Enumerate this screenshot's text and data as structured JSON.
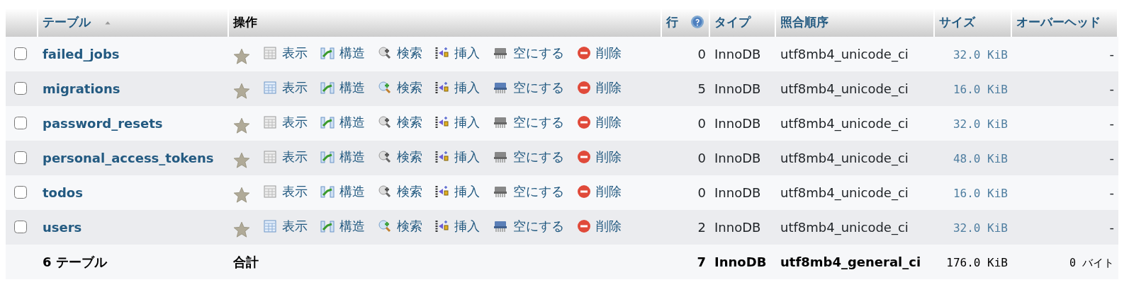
{
  "header": {
    "columns": [
      {
        "label": "テーブル",
        "sortable": true,
        "sorted": true
      },
      {
        "label": "操作",
        "sortable": false
      },
      {
        "label": "行",
        "sortable": true,
        "help": true
      },
      {
        "label": "タイプ",
        "sortable": true
      },
      {
        "label": "照合順序",
        "sortable": true
      },
      {
        "label": "サイズ",
        "sortable": true
      },
      {
        "label": "オーバーヘッド",
        "sortable": true
      }
    ]
  },
  "rows": [
    {
      "name": "failed_jobs",
      "checked": false,
      "favorite": false,
      "empty": true,
      "actions": [
        {
          "kind": "browse",
          "label": "表示"
        },
        {
          "kind": "structure",
          "label": "構造"
        },
        {
          "kind": "search",
          "label": "検索"
        },
        {
          "kind": "insert",
          "label": "挿入"
        },
        {
          "kind": "truncate",
          "label": "空にする"
        },
        {
          "kind": "drop",
          "label": "削除"
        }
      ],
      "row_count": "0",
      "type": "InnoDB",
      "collation": "utf8mb4_unicode_ci",
      "size": "32.0 KiB",
      "overhead": "-"
    },
    {
      "name": "migrations",
      "checked": false,
      "favorite": false,
      "empty": false,
      "actions": [
        {
          "kind": "browse",
          "label": "表示"
        },
        {
          "kind": "structure",
          "label": "構造"
        },
        {
          "kind": "search",
          "label": "検索"
        },
        {
          "kind": "insert",
          "label": "挿入"
        },
        {
          "kind": "truncate",
          "label": "空にする"
        },
        {
          "kind": "drop",
          "label": "削除"
        }
      ],
      "row_count": "5",
      "type": "InnoDB",
      "collation": "utf8mb4_unicode_ci",
      "size": "16.0 KiB",
      "overhead": "-"
    },
    {
      "name": "password_resets",
      "checked": false,
      "favorite": false,
      "empty": true,
      "actions": [
        {
          "kind": "browse",
          "label": "表示"
        },
        {
          "kind": "structure",
          "label": "構造"
        },
        {
          "kind": "search",
          "label": "検索"
        },
        {
          "kind": "insert",
          "label": "挿入"
        },
        {
          "kind": "truncate",
          "label": "空にする"
        },
        {
          "kind": "drop",
          "label": "削除"
        }
      ],
      "row_count": "0",
      "type": "InnoDB",
      "collation": "utf8mb4_unicode_ci",
      "size": "32.0 KiB",
      "overhead": "-"
    },
    {
      "name": "personal_access_tokens",
      "checked": false,
      "favorite": false,
      "empty": true,
      "actions": [
        {
          "kind": "browse",
          "label": "表示"
        },
        {
          "kind": "structure",
          "label": "構造"
        },
        {
          "kind": "search",
          "label": "検索"
        },
        {
          "kind": "insert",
          "label": "挿入"
        },
        {
          "kind": "truncate",
          "label": "空にする"
        },
        {
          "kind": "drop",
          "label": "削除"
        }
      ],
      "row_count": "0",
      "type": "InnoDB",
      "collation": "utf8mb4_unicode_ci",
      "size": "48.0 KiB",
      "overhead": "-"
    },
    {
      "name": "todos",
      "checked": false,
      "favorite": false,
      "empty": true,
      "actions": [
        {
          "kind": "browse",
          "label": "表示"
        },
        {
          "kind": "structure",
          "label": "構造"
        },
        {
          "kind": "search",
          "label": "検索"
        },
        {
          "kind": "insert",
          "label": "挿入"
        },
        {
          "kind": "truncate",
          "label": "空にする"
        },
        {
          "kind": "drop",
          "label": "削除"
        }
      ],
      "row_count": "0",
      "type": "InnoDB",
      "collation": "utf8mb4_unicode_ci",
      "size": "16.0 KiB",
      "overhead": "-"
    },
    {
      "name": "users",
      "checked": false,
      "favorite": false,
      "empty": false,
      "actions": [
        {
          "kind": "browse",
          "label": "表示"
        },
        {
          "kind": "structure",
          "label": "構造"
        },
        {
          "kind": "search",
          "label": "検索"
        },
        {
          "kind": "insert",
          "label": "挿入"
        },
        {
          "kind": "truncate",
          "label": "空にする"
        },
        {
          "kind": "drop",
          "label": "削除"
        }
      ],
      "row_count": "2",
      "type": "InnoDB",
      "collation": "utf8mb4_unicode_ci",
      "size": "32.0 KiB",
      "overhead": "-"
    }
  ],
  "footer": {
    "table_count": "6 テーブル",
    "total_label": "合計",
    "row_count": "7",
    "type": "InnoDB",
    "collation": "utf8mb4_general_ci",
    "size": "176.0 KiB",
    "overhead": "0 バイト"
  }
}
